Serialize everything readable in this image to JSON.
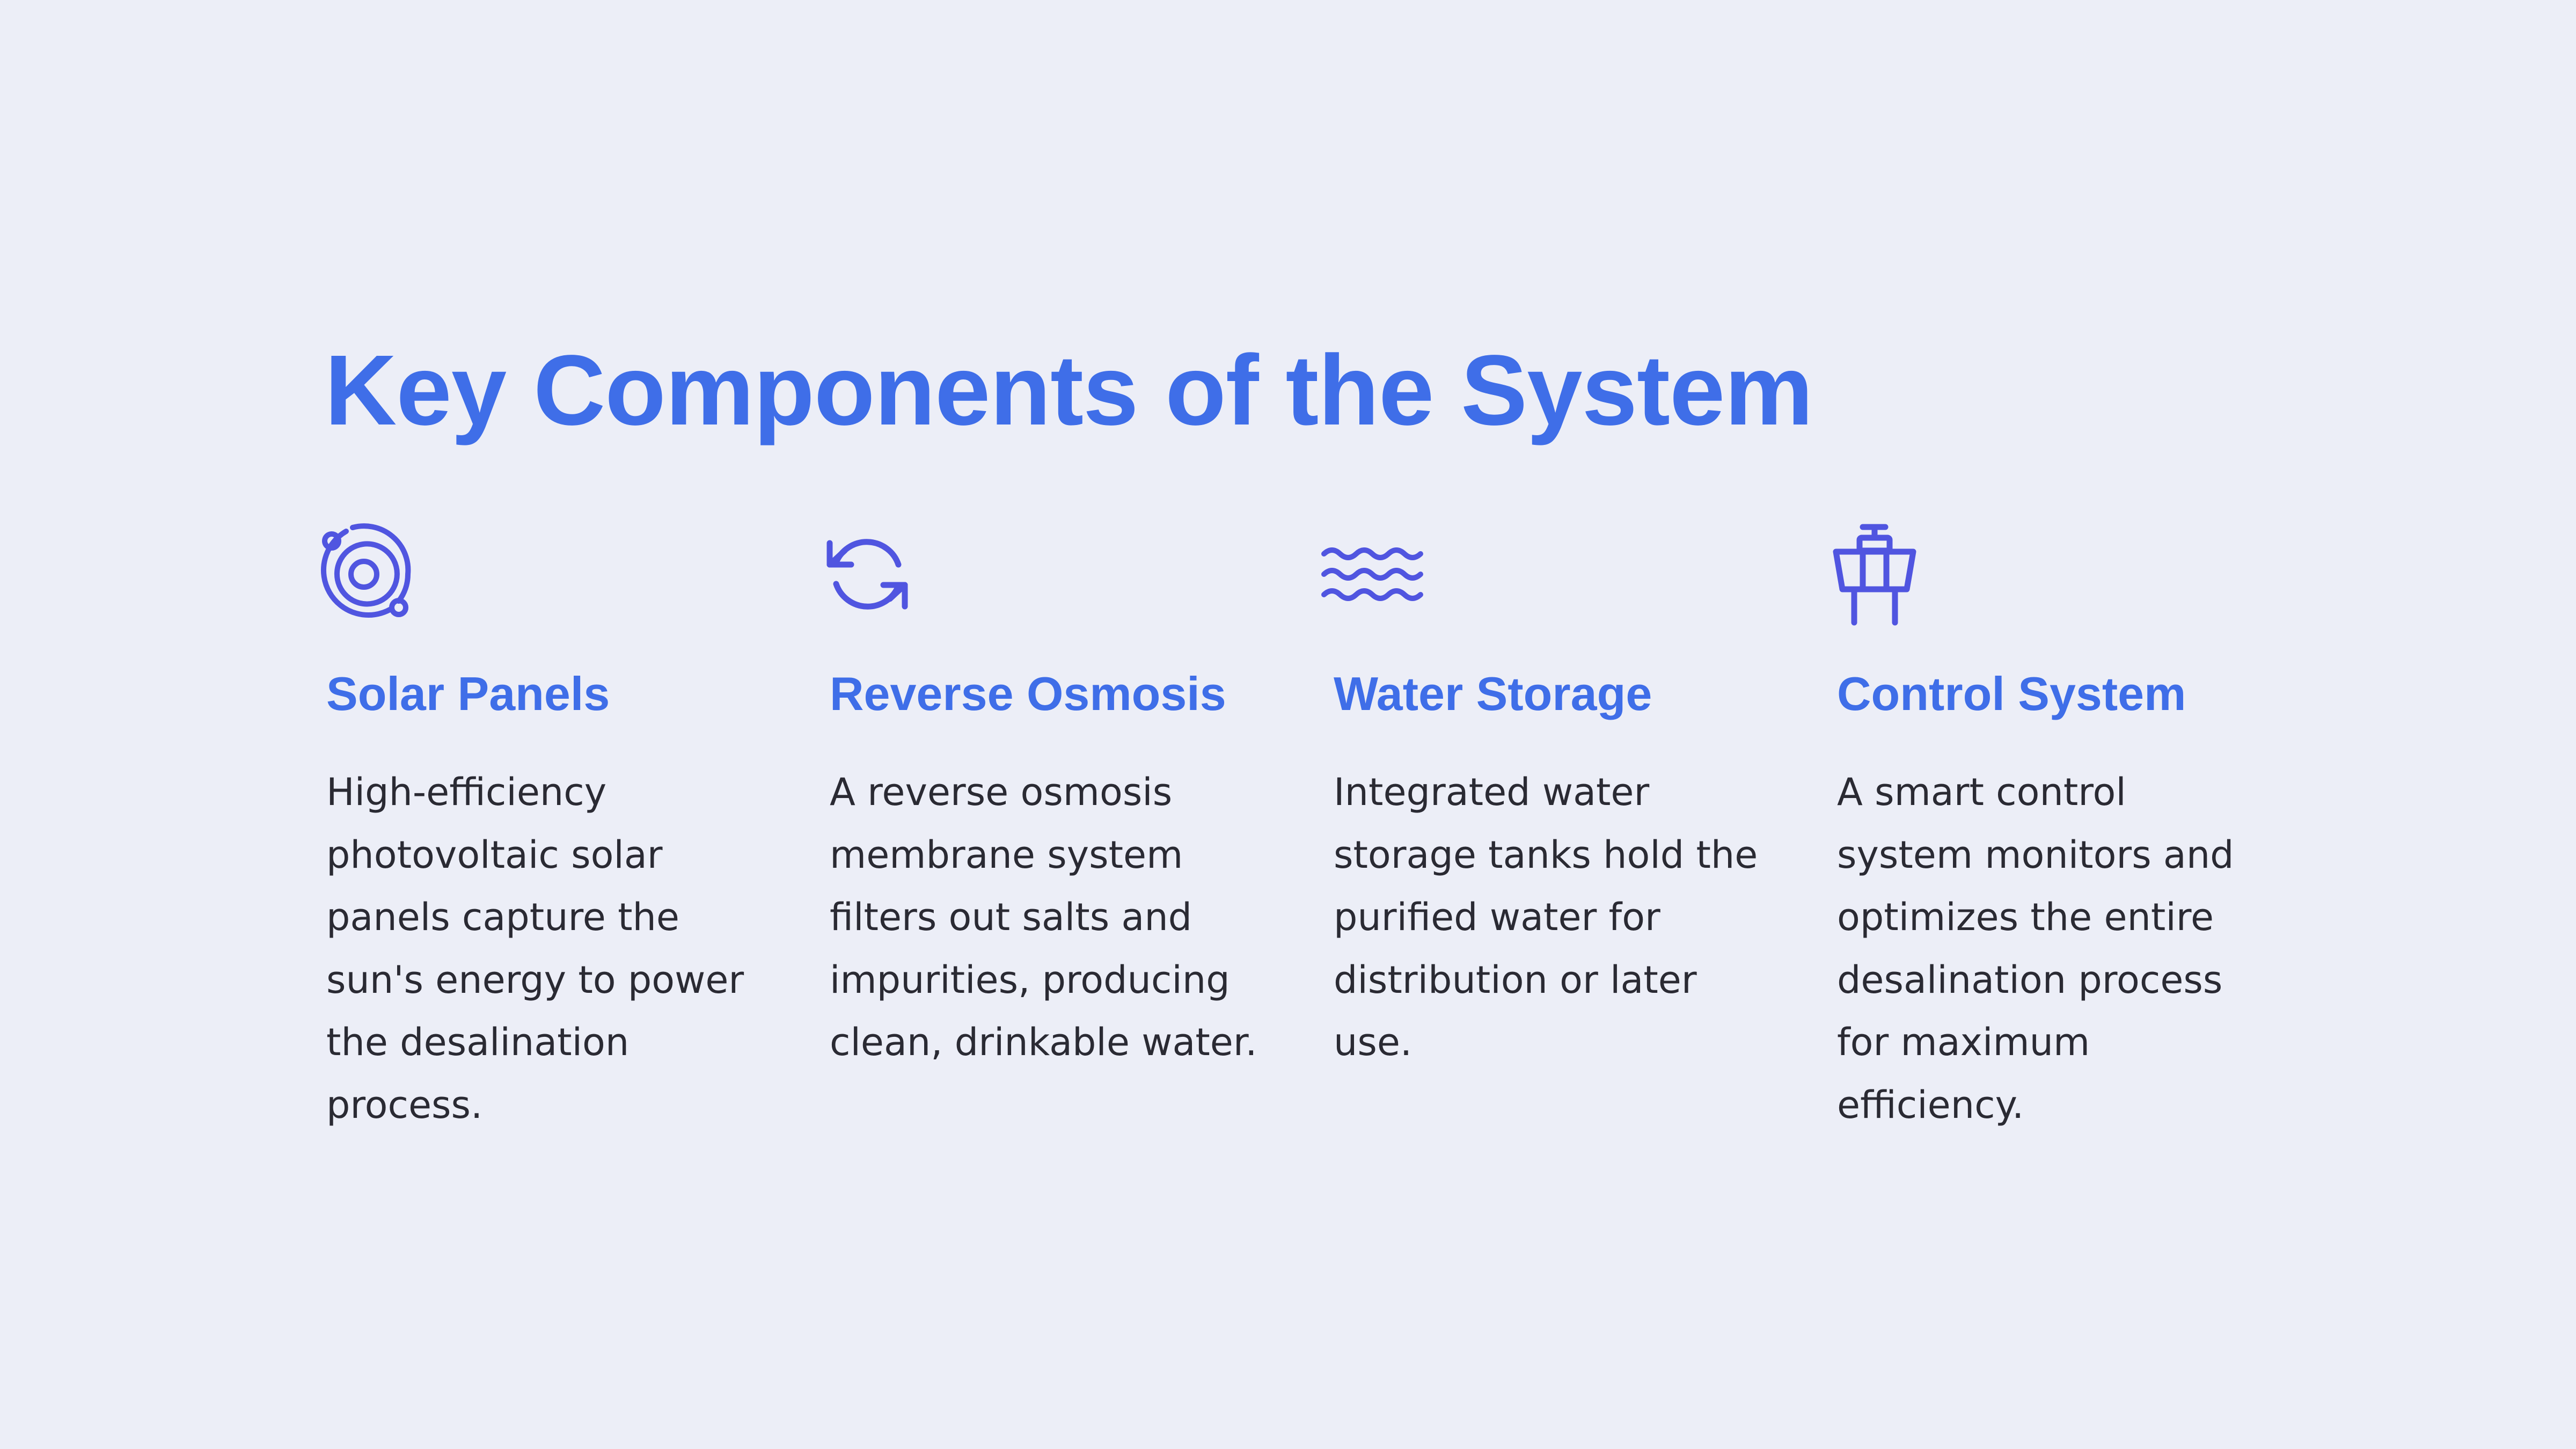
{
  "slide": {
    "title": "Key Components of the System",
    "accent_color": "#3f6ee8",
    "icon_color": "#5055e0",
    "background_color": "#eceef7"
  },
  "components": [
    {
      "icon": "orbit-icon",
      "heading": "Solar Panels",
      "body": "High-efficiency photovoltaic solar panels capture the sun's energy to power the desalination process."
    },
    {
      "icon": "refresh-arrows-icon",
      "heading": "Reverse Osmosis",
      "body": "A reverse osmosis membrane system filters out salts and impurities, producing clean, drinkable water."
    },
    {
      "icon": "water-waves-icon",
      "heading": "Water Storage",
      "body": "Integrated water storage tanks hold the purified water for distribution or later use."
    },
    {
      "icon": "control-station-icon",
      "heading": "Control System",
      "body": "A smart control system monitors and optimizes the entire desalination process for maximum efficiency."
    }
  ]
}
